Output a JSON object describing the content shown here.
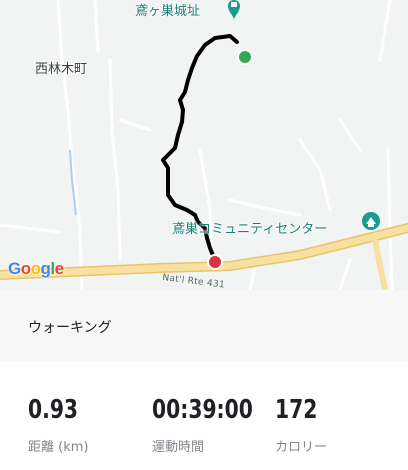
{
  "map": {
    "labels": {
      "castle": "鳶ヶ巣城址",
      "town": "西林木町",
      "community_center": "鳶巣コミュニティセンター",
      "road": "Nat'l Rte 431"
    },
    "google_logo": [
      "G",
      "o",
      "o",
      "g",
      "l",
      "e"
    ],
    "colors": {
      "route": "#000000",
      "start_marker": "#34a853",
      "end_marker": "#d93343",
      "poi": "#1a9c8c",
      "road": "#f6d98c"
    }
  },
  "activity": {
    "type": "ウォーキング"
  },
  "stats": [
    {
      "value": "0.93",
      "label": "距離 (km)"
    },
    {
      "value": "00:39:00",
      "label": "運動時間"
    },
    {
      "value": "172",
      "label": "カロリー"
    }
  ]
}
